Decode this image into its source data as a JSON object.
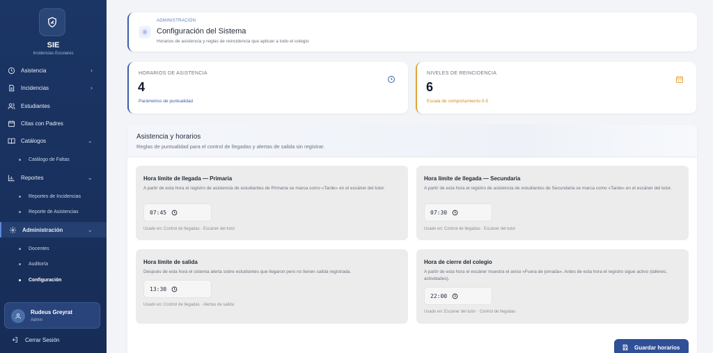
{
  "app": {
    "brand": "SIE",
    "subtitle": "Incidencias Escolares"
  },
  "sidebar": {
    "items": [
      {
        "label": "Asistencia",
        "icon": "clock-icon",
        "chevron": "›"
      },
      {
        "label": "Incidencias",
        "icon": "file-icon",
        "chevron": "›"
      },
      {
        "label": "Estudiantes",
        "icon": "users-icon"
      },
      {
        "label": "Citas con Padres",
        "icon": "calendar-icon"
      },
      {
        "label": "Catálogos",
        "icon": "book-icon",
        "chevron": "⌄"
      },
      {
        "label": "Reportes",
        "icon": "bar-chart-icon",
        "chevron": "⌄"
      },
      {
        "label": "Administración",
        "icon": "gear-icon",
        "chevron": "⌄"
      }
    ],
    "subitems": {
      "catalogos": [
        "Catálogo de Faltas"
      ],
      "reportes": [
        "Reportes de Incidencias",
        "Reporte de Asistencias"
      ],
      "administracion": [
        "Docentes",
        "Auditoría",
        "Configuración"
      ]
    },
    "user": {
      "name": "Rudeus Greyrat",
      "role": "Admin"
    },
    "logout": "Cerrar Sesión"
  },
  "header": {
    "eyebrow": "ADMINISTRACIÓN",
    "title": "Configuración del Sistema",
    "subtitle": "Horarios de asistencia y reglas de reincidencia que aplican a todo el colegio"
  },
  "stats": [
    {
      "label": "HORARIOS DE ASISTENCIA",
      "value": "4",
      "foot": "Parámetros de puntualidad",
      "icon": "clock-icon",
      "color": "#3b5ba5"
    },
    {
      "label": "NIVELES DE REINCIDENCIA",
      "value": "6",
      "foot": "Escala de comportamiento 0-5",
      "icon": "calendar-icon",
      "color": "#e0a43a"
    }
  ],
  "section": {
    "title": "Asistencia y horarios",
    "subtitle": "Reglas de puntualidad para el control de llegadas y alertas de salida sin registrar."
  },
  "settings": [
    {
      "title": "Hora límite de llegada — Primaria",
      "desc": "A partir de esta hora el registro de asistencia de estudiantes de Primaria se marca como «Tarde» en el escáner del tutor.",
      "time": "07:45",
      "used": "Usado en: Control de llegadas · Escáner del tutor"
    },
    {
      "title": "Hora límite de llegada — Secundaria",
      "desc": "A partir de esta hora el registro de asistencia de estudiantes de Secundaria se marca como «Tarde» en el escáner del tutor.",
      "time": "07:30",
      "used": "Usado en: Control de llegadas · Escáner del tutor"
    },
    {
      "title": "Hora límite de salida",
      "desc": "Después de esta hora el sistema alerta sobre estudiantes que llegaron pero no tienen salida registrada.",
      "time": "13:30",
      "used": "Usado en: Control de llegadas · Alertas de salida"
    },
    {
      "title": "Hora de cierre del colegio",
      "desc": "A partir de esta hora el escáner muestra el aviso «Fuera de jornada». Antes de esta hora el registro sigue activo (talleres, actividades).",
      "time": "22:00",
      "used": "Usado en: Escáner del tutor · Control de llegadas"
    }
  ],
  "actions": {
    "save": "Guardar horarios"
  },
  "colors": {
    "sidebar": "#1b3565",
    "accent": "#3b5ba5",
    "warning": "#e0a43a",
    "button": "#2f4f96"
  }
}
